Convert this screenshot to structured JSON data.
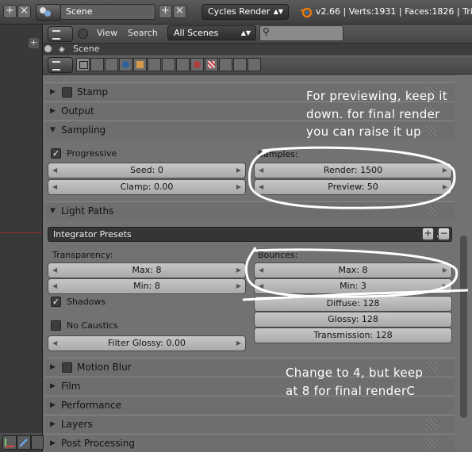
{
  "topbar": {
    "scene": "Scene",
    "renderer": "Cycles Render",
    "stats": "v2.66 | Verts:1931 | Faces:1826 | Tri"
  },
  "outliner": {
    "menu_view": "View",
    "menu_search": "Search",
    "display_mode": "All Scenes",
    "search_placeholder": "",
    "scene_row": "Scene"
  },
  "panels": {
    "stamp": "Stamp",
    "output": "Output",
    "sampling": "Sampling",
    "light_paths": "Light Paths",
    "motion_blur": "Motion Blur",
    "film": "Film",
    "performance": "Performance",
    "layers": "Layers",
    "post_processing": "Post Processing"
  },
  "sampling": {
    "progressive_label": "Progressive",
    "progressive_checked": true,
    "seed": "Seed: 0",
    "clamp": "Clamp: 0.00",
    "samples_label": "Samples:",
    "render": "Render: 1500",
    "preview": "Preview: 50"
  },
  "light_paths": {
    "integrator_presets": "Integrator Presets",
    "transparency_label": "Transparency:",
    "t_max": "Max: 8",
    "t_min": "Min: 8",
    "shadows_label": "Shadows",
    "shadows_checked": true,
    "no_caustics_label": "No Caustics",
    "filter_glossy": "Filter Glossy: 0.00",
    "bounces_label": "Bounces:",
    "b_max": "Max: 8",
    "b_min": "Min: 3",
    "diffuse": "Diffuse: 128",
    "glossy": "Glossy: 128",
    "transmission": "Transmission: 128"
  },
  "annotations": {
    "note1_line1": "For previewing, keep it",
    "note1_line2": "down. for final render",
    "note1_line3": "you can raise it up",
    "note2_line1": "Change to 4, but keep",
    "note2_line2": "at 8 for final renderC"
  },
  "colors": {
    "panel_bg": "#727272",
    "annotation": "#ffffff"
  }
}
